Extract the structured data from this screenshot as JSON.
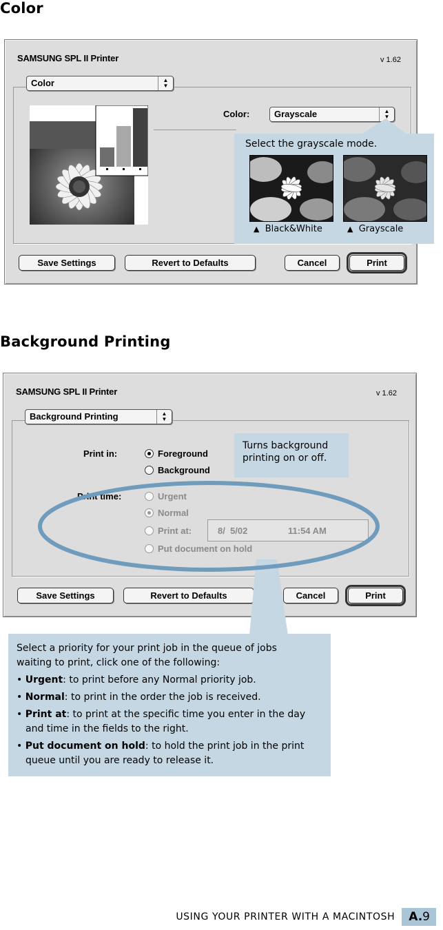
{
  "sections": {
    "color_heading": "Color",
    "background_heading": "Background Printing"
  },
  "color_dialog": {
    "title": "SAMSUNG SPL II Printer",
    "version": "v 1.62",
    "panel_popup": "Color",
    "color_label": "Color:",
    "color_popup": "Grayscale",
    "buttons": {
      "save": "Save Settings",
      "revert": "Revert to Defaults",
      "cancel": "Cancel",
      "print": "Print"
    }
  },
  "color_callout": {
    "text": "Select the grayscale mode.",
    "caption_bw": "Black&White",
    "caption_gray": "Grayscale",
    "marker": "▲"
  },
  "bg_dialog": {
    "title": "SAMSUNG SPL II Printer",
    "version": "v 1.62",
    "panel_popup": "Background Printing",
    "print_in_label": "Print in:",
    "foreground": "Foreground",
    "background": "Background",
    "print_time_label": "Print time:",
    "urgent": "Urgent",
    "normal": "Normal",
    "print_at": "Print at:",
    "date": "8/  5/02",
    "time": "11:54 AM",
    "put_on_hold": "Put document on hold",
    "buttons": {
      "save": "Save Settings",
      "revert": "Revert to Defaults",
      "cancel": "Cancel",
      "print": "Print"
    }
  },
  "bg_callout": {
    "line1": "Turns background",
    "line2": "printing on or off."
  },
  "priority_callout": {
    "intro1": "Select a priority for your print job in the queue of jobs",
    "intro2": "waiting to print, click one of the following:",
    "bullet": "•",
    "urgent_term": "Urgent",
    "urgent_desc": ": to print before any Normal priority job.",
    "normal_term": "Normal",
    "normal_desc": ": to print in the order the job is received.",
    "printat_term": "Print at",
    "printat_desc1": ": to print at the specific time you enter in the day",
    "printat_desc2": "and time in the fields to the right.",
    "hold_term": "Put document on hold",
    "hold_desc1": ": to hold the print job in the print",
    "hold_desc2": "queue until you are ready to release it."
  },
  "footer": {
    "text": "USING YOUR PRINTER WITH A MACINTOSH",
    "page_prefix": "A.",
    "page_number": "9"
  },
  "colors": {
    "callout_bg": "#c4d7e3",
    "badge_bg": "#aac5d5",
    "ellipse": "#6f9bbd"
  }
}
